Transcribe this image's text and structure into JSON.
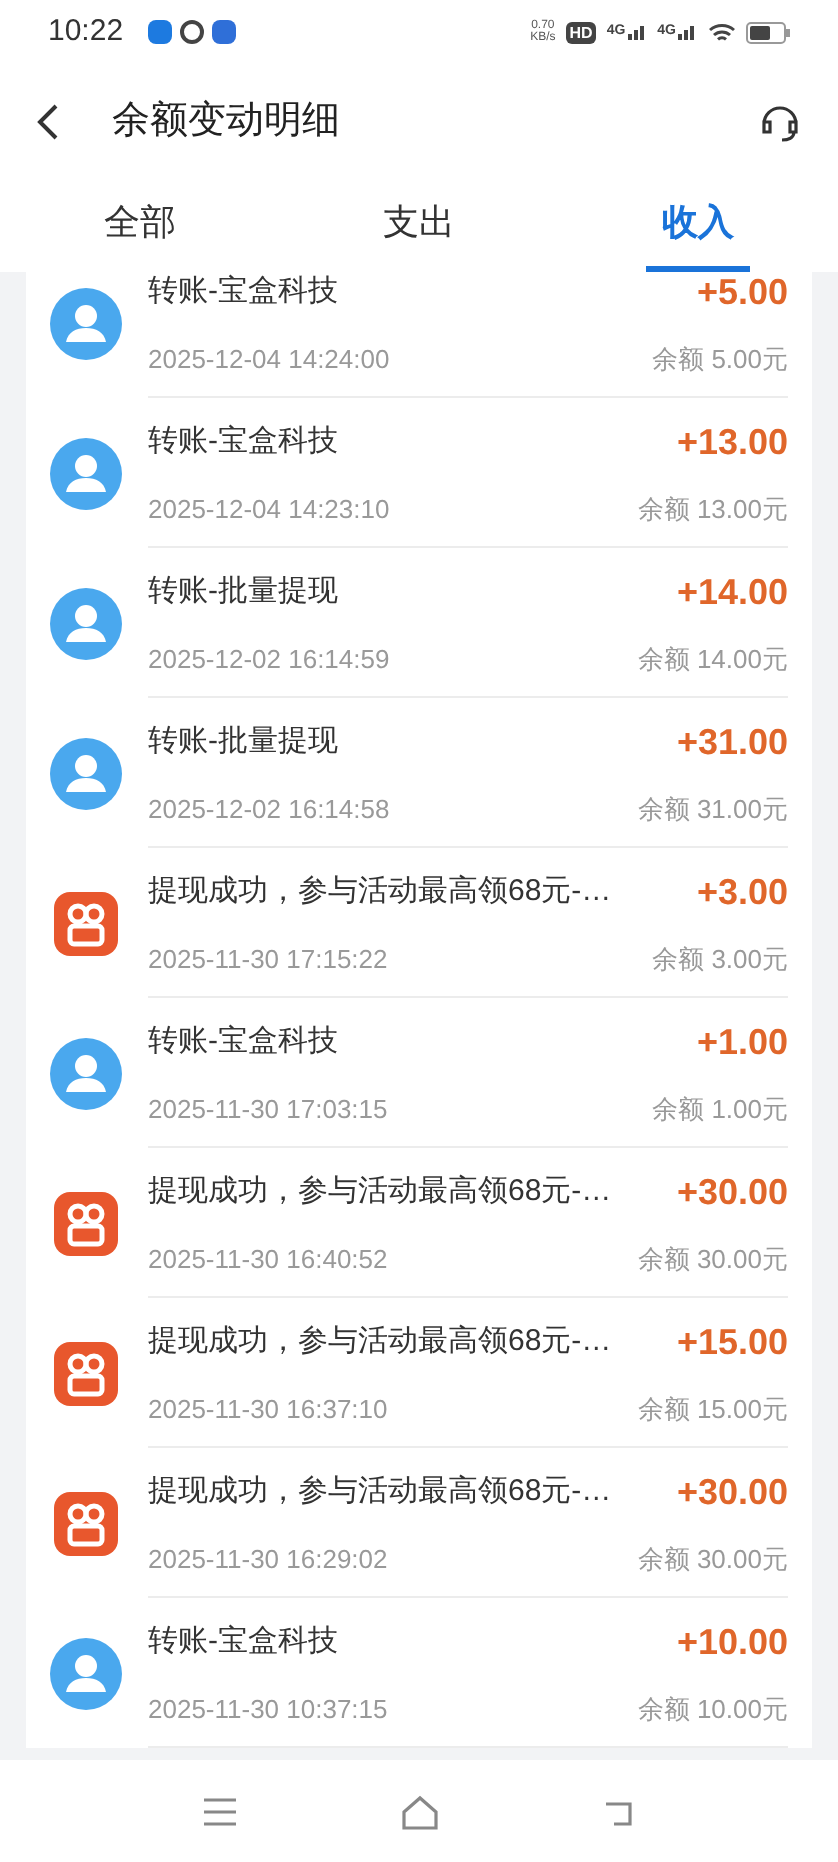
{
  "status_bar": {
    "time": "10:22",
    "net_speed": "0.70",
    "net_unit": "KB/s",
    "hd": "HD",
    "signals": [
      "4G",
      "4G"
    ]
  },
  "header": {
    "title": "余额变动明细"
  },
  "tabs": [
    {
      "label": "全部",
      "selected": false
    },
    {
      "label": "支出",
      "selected": false
    },
    {
      "label": "收入",
      "selected": true
    }
  ],
  "transactions": [
    {
      "kind": "person",
      "title": "转账-宝盒科技",
      "time": "2025-12-04 14:24:00",
      "amount": "+5.00",
      "balance": "余额 5.00元"
    },
    {
      "kind": "person",
      "title": "转账-宝盒科技",
      "time": "2025-12-04 14:23:10",
      "amount": "+13.00",
      "balance": "余额 13.00元"
    },
    {
      "kind": "person",
      "title": "转账-批量提现",
      "time": "2025-12-02 16:14:59",
      "amount": "+14.00",
      "balance": "余额 14.00元"
    },
    {
      "kind": "person",
      "title": "转账-批量提现",
      "time": "2025-12-02 16:14:58",
      "amount": "+31.00",
      "balance": "余额 31.00元"
    },
    {
      "kind": "app",
      "title": "提现成功，参与活动最高领68元-…",
      "time": "2025-11-30 17:15:22",
      "amount": "+3.00",
      "balance": "余额 3.00元"
    },
    {
      "kind": "person",
      "title": "转账-宝盒科技",
      "time": "2025-11-30 17:03:15",
      "amount": "+1.00",
      "balance": "余额 1.00元"
    },
    {
      "kind": "app",
      "title": "提现成功，参与活动最高领68元-…",
      "time": "2025-11-30 16:40:52",
      "amount": "+30.00",
      "balance": "余额 30.00元"
    },
    {
      "kind": "app",
      "title": "提现成功，参与活动最高领68元-…",
      "time": "2025-11-30 16:37:10",
      "amount": "+15.00",
      "balance": "余额 15.00元"
    },
    {
      "kind": "app",
      "title": "提现成功，参与活动最高领68元-…",
      "time": "2025-11-30 16:29:02",
      "amount": "+30.00",
      "balance": "余额 30.00元"
    },
    {
      "kind": "person",
      "title": "转账-宝盒科技",
      "time": "2025-11-30 10:37:15",
      "amount": "+10.00",
      "balance": "余额 10.00元"
    }
  ]
}
